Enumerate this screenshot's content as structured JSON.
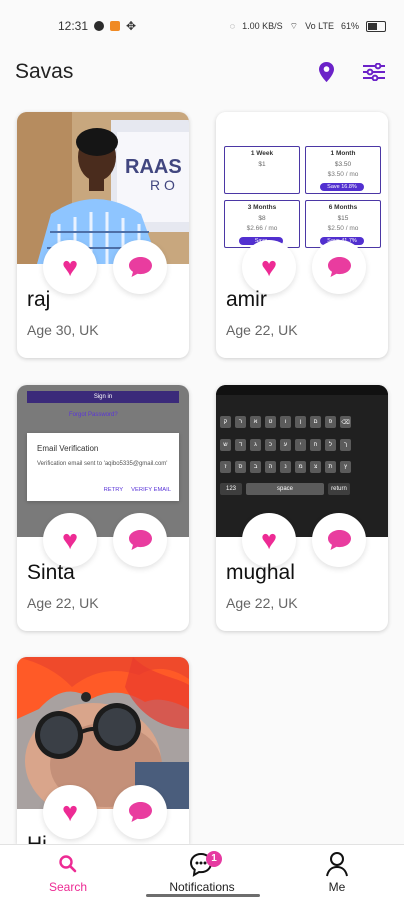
{
  "status": {
    "time": "12:31",
    "network": "1.00 KB/S",
    "signal": "Vo LTE",
    "battery": "61%"
  },
  "header": {
    "title": "Savas"
  },
  "colors": {
    "accent": "#6b22c8",
    "heart": "#ed2b94",
    "chat": "#e93c9f"
  },
  "cards": [
    {
      "name": "raj",
      "age": "Age 30, UK",
      "photo_text": "RAAS"
    },
    {
      "name": "amir",
      "age": "Age 22, UK",
      "plans": [
        {
          "title": "1 Week",
          "price": "$1",
          "note": ""
        },
        {
          "title": "1 Month",
          "price": "$3.50",
          "note": "$3.50 / mo",
          "badge": "Save 16.8%"
        },
        {
          "title": "3 Months",
          "price": "$8",
          "note": "$2.66 / mo",
          "badge": "Save"
        },
        {
          "title": "6 Months",
          "price": "$15",
          "note": "$2.50 / mo",
          "badge": "Save 41.7%"
        }
      ]
    },
    {
      "name": "Sinta",
      "age": "Age 22, UK",
      "screen_title": "Sign in",
      "screen_link": "Forgot Password?",
      "dialog_title": "Email Verification",
      "dialog_text": "Verification email sent to 'aqibo5335@gmail.com'",
      "dialog_retry": "RETRY",
      "dialog_verify": "VERIFY EMAIL"
    },
    {
      "name": "mughal",
      "age": "Age 22, UK",
      "keyboard_labels": [
        "123",
        "space",
        "return"
      ]
    },
    {
      "name": "Hi",
      "age": ""
    }
  ],
  "nav": {
    "search": "Search",
    "notifications": "Notifications",
    "me": "Me",
    "notification_count": "1"
  }
}
